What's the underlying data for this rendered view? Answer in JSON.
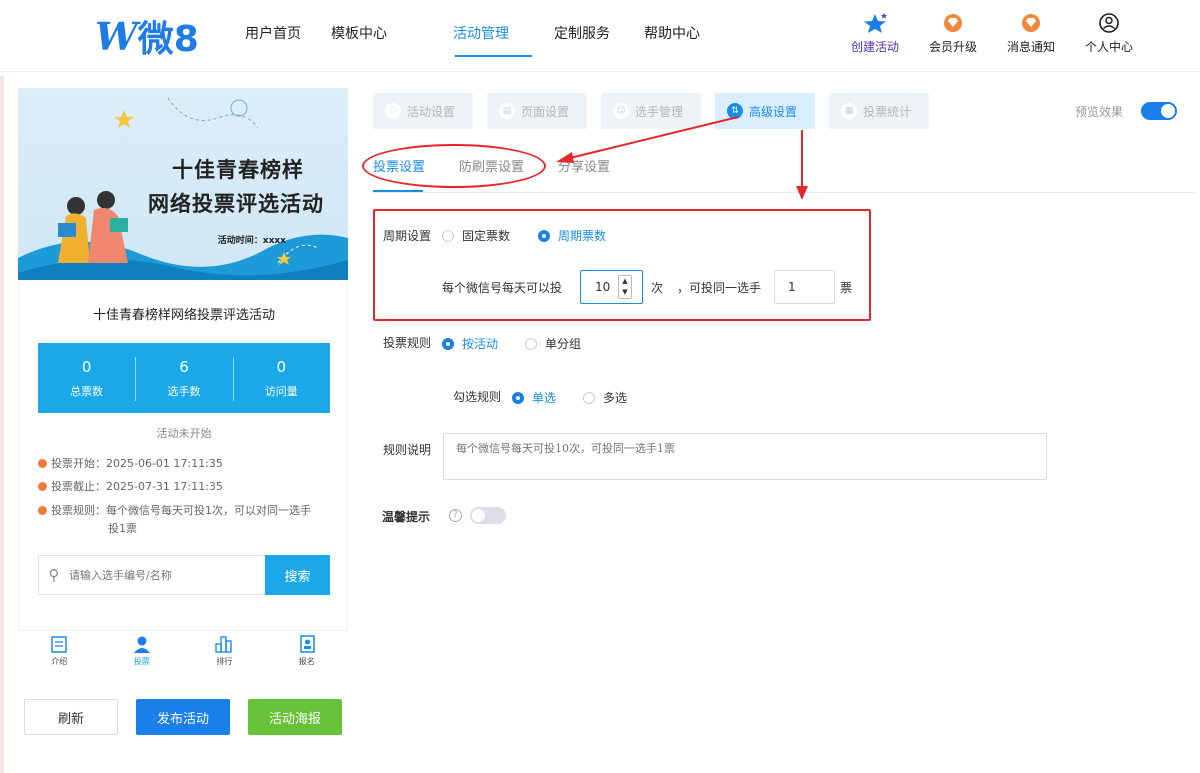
{
  "header": {
    "logo_text": "微8",
    "nav": [
      "用户首页",
      "模板中心",
      "活动管理",
      "定制服务",
      "帮助中心"
    ],
    "right": [
      {
        "label": "创建活动",
        "icon": "star-icon"
      },
      {
        "label": "会员升级",
        "icon": "gem-icon"
      },
      {
        "label": "消息通知",
        "icon": "gem-icon"
      },
      {
        "label": "个人中心",
        "icon": "user-icon"
      }
    ]
  },
  "preview": {
    "banner_title1": "十佳青春榜样",
    "banner_title2": "网络投票评选活动",
    "banner_time": "活动时间：xxxx",
    "card_title": "十佳青春榜样网络投票评选活动",
    "stats": [
      {
        "num": "0",
        "label": "总票数"
      },
      {
        "num": "6",
        "label": "选手数"
      },
      {
        "num": "0",
        "label": "访问量"
      }
    ],
    "status": "活动未开始",
    "vote_start": "投票开始：2025-06-01 17:11:35",
    "vote_end": "投票截止：2025-07-31 17:11:35",
    "vote_rule_line1": "投票规则：每个微信号每天可投1次，可以对同一选手",
    "vote_rule_line2": "投1票",
    "search_placeholder": "请输入选手编号/名称",
    "search_button": "搜索",
    "tabs": [
      "介绍",
      "投票",
      "排行",
      "报名"
    ]
  },
  "actions": {
    "refresh": "刷新",
    "publish": "发布活动",
    "poster": "活动海报"
  },
  "steps": [
    "活动设置",
    "页面设置",
    "选手管理",
    "高级设置",
    "投票统计"
  ],
  "preview_effect": "预览效果",
  "sub_tabs": [
    "投票设置",
    "防刷票设置",
    "分享设置"
  ],
  "period": {
    "label": "周期设置",
    "options": [
      "固定票数",
      "周期票数"
    ],
    "text_before": "每个微信号每天可以投",
    "count": "10",
    "text_times": "次",
    "text_same": "，可投同一选手",
    "same_count": "1",
    "text_votes": "票"
  },
  "vote_rule": {
    "label": "投票规则",
    "options": [
      "按活动",
      "单分组"
    ]
  },
  "check_rule": {
    "label": "勾选规则",
    "options": [
      "单选",
      "多选"
    ]
  },
  "rule_desc": {
    "label": "规则说明",
    "placeholder": "每个微信号每天可投10次，可投同一选手1票"
  },
  "tip": {
    "label": "温馨提示"
  },
  "colors": {
    "accent": "#1a8de8",
    "annotation": "#e8252a",
    "stats_bg": "#1ba8e8",
    "poster": "#67c23a"
  }
}
